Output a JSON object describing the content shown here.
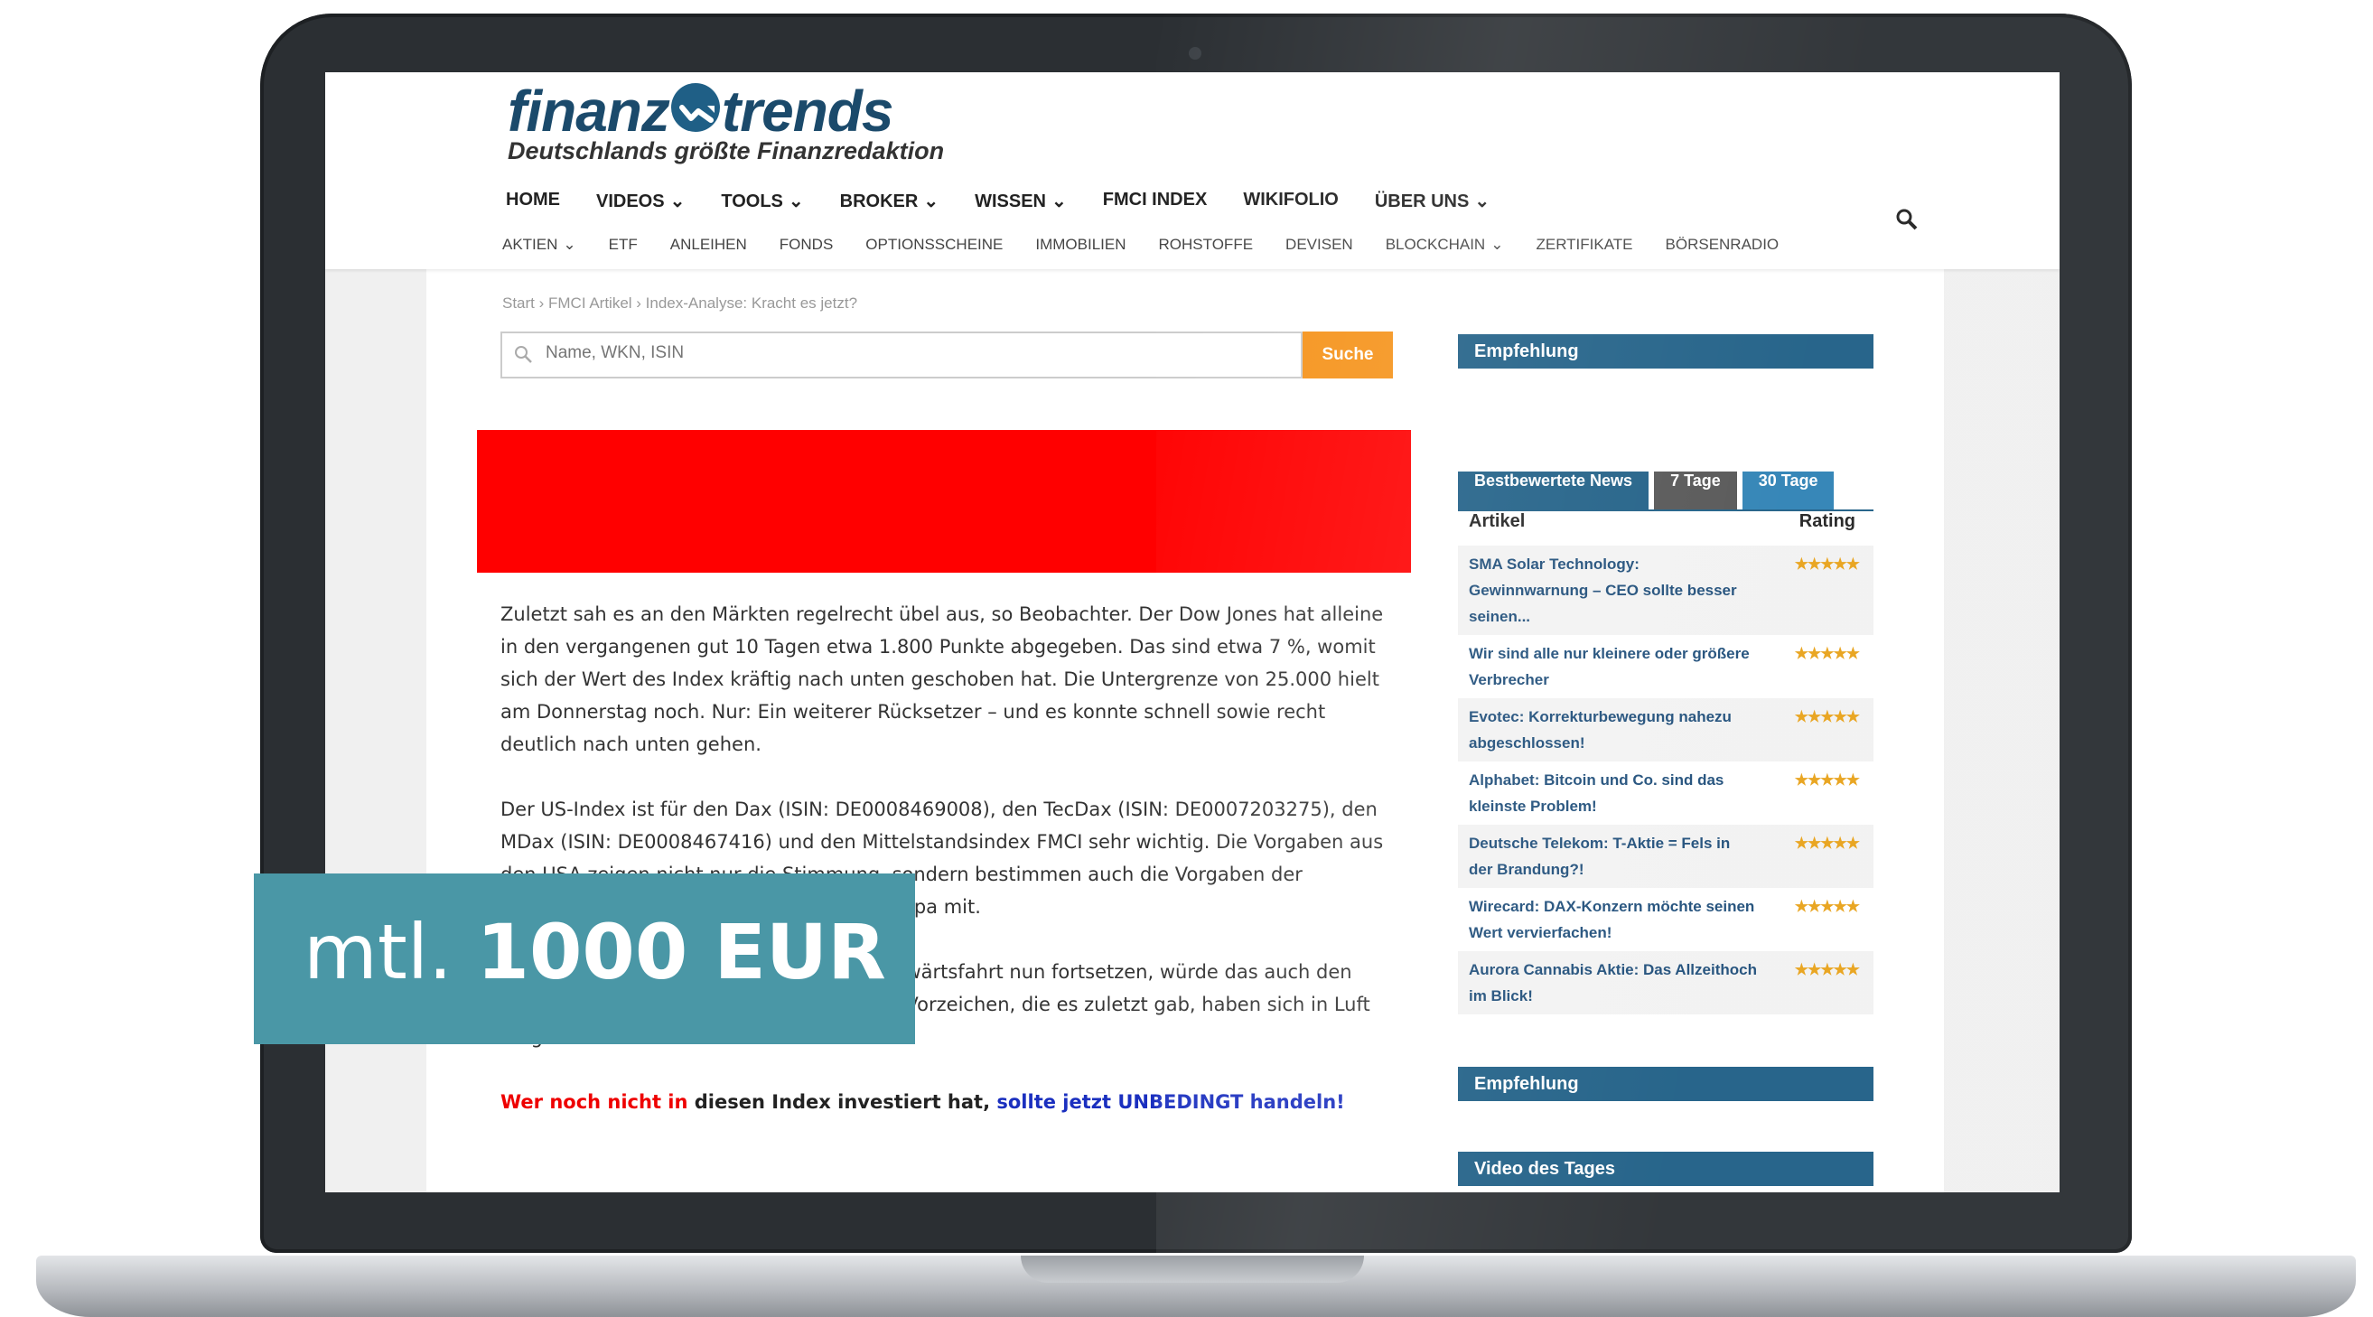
{
  "header": {
    "logo_left": "finanz",
    "logo_right": "trends",
    "tagline": "Deutschlands größte Finanzredaktion"
  },
  "nav_main": [
    {
      "label": "HOME",
      "dropdown": false
    },
    {
      "label": "VIDEOS",
      "dropdown": true
    },
    {
      "label": "TOOLS",
      "dropdown": true
    },
    {
      "label": "BROKER",
      "dropdown": true
    },
    {
      "label": "WISSEN",
      "dropdown": true
    },
    {
      "label": "FMCI INDEX",
      "dropdown": false
    },
    {
      "label": "WIKIFOLIO",
      "dropdown": false
    },
    {
      "label": "ÜBER UNS",
      "dropdown": true
    }
  ],
  "nav_sub": [
    {
      "label": "AKTIEN",
      "dropdown": true
    },
    {
      "label": "ETF",
      "dropdown": false
    },
    {
      "label": "ANLEIHEN",
      "dropdown": false
    },
    {
      "label": "FONDS",
      "dropdown": false
    },
    {
      "label": "OPTIONSSCHEINE",
      "dropdown": false
    },
    {
      "label": "IMMOBILIEN",
      "dropdown": false
    },
    {
      "label": "ROHSTOFFE",
      "dropdown": false
    },
    {
      "label": "DEVISEN",
      "dropdown": false
    },
    {
      "label": "BLOCKCHAIN",
      "dropdown": true
    },
    {
      "label": "ZERTIFIKATE",
      "dropdown": false
    },
    {
      "label": "BÖRSENRADIO",
      "dropdown": false
    }
  ],
  "breadcrumb": "Start  ›  FMCI Artikel  ›  Index-Analyse: Kracht es jetzt?",
  "search": {
    "placeholder": "Name, WKN, ISIN",
    "button": "Suche"
  },
  "article": {
    "p1": "Zuletzt sah es an den Märkten regelrecht übel aus, so Beobachter. Der Dow Jones hat alleine in den vergangenen gut 10 Tagen etwa 1.800 Punkte abgegeben. Das sind etwa 7 %, womit sich der Wert des Index kräftig nach unten geschoben hat. Die Untergrenze von 25.000 hielt am Donnerstag noch. Nur: Ein weiterer Rücksetzer – und es konnte schnell sowie recht deutlich nach unten gehen.",
    "p2": "Der US-Index ist für den Dax (ISIN: DE0008469008), den TecDax (ISIN: DE0007203275), den MDax (ISIN: DE0008467416) und den Mittelstandsindex FMCI sehr wichtig. Die Vorgaben aus den USA zeigen nicht nur die Stimmung, sondern bestimmen auch die Vorgaben der anlegenden Fonds etwa dann auch für Europa mit.",
    "p3": "Dax, MDax und TecDax ihre kurzfristige Abwärtsfahrt nun fortsetzen, würde das auch den Pessimisten für Panik-Techniker. Die guten Vorzeichen, die es zuletzt gab, haben sich in Luft aufgelöst.",
    "cta_red": "Wer noch nicht in",
    "cta_black": " diesen Index investiert hat, ",
    "cta_blue": "sollte jetzt UNBEDINGT handeln!"
  },
  "sidebar": {
    "empfehlung1": "Empfehlung",
    "tabs": [
      "Bestbewertete News",
      "7 Tage",
      "30 Tage"
    ],
    "col_article": "Artikel",
    "col_rating": "Rating",
    "rows": [
      {
        "title": "SMA Solar Technology: Gewinnwarnung – CEO sollte besser seinen...",
        "rating": 5
      },
      {
        "title": "Wir sind alle nur kleinere oder größere Verbrecher",
        "rating": 5
      },
      {
        "title": "Evotec: Korrekturbewegung nahezu abgeschlossen!",
        "rating": 5
      },
      {
        "title": "Alphabet: Bitcoin und Co. sind das kleinste Problem!",
        "rating": 5
      },
      {
        "title": "Deutsche Telekom: T-Aktie = Fels in der Brandung?!",
        "rating": 5
      },
      {
        "title": "Wirecard: DAX-Konzern möchte seinen Wert vervierfachen!",
        "rating": 5
      },
      {
        "title": "Aurora Cannabis Aktie: Das Allzeithoch im Blick!",
        "rating": 5
      }
    ],
    "empfehlung2": "Empfehlung",
    "video": "Video des Tages"
  },
  "overlay": {
    "prefix": "mtl. ",
    "amount": "1000 EUR"
  },
  "colors": {
    "brand_blue": "#1f5f86",
    "search_orange": "#f5941d",
    "banner_red": "#ff0000",
    "overlay_teal": "#4a97a6"
  }
}
